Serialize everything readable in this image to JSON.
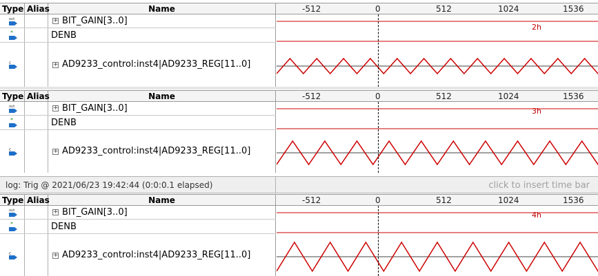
{
  "columns": {
    "type": "Type",
    "alias": "Alias",
    "name": "Name"
  },
  "timeline": {
    "ticks": [
      "-512",
      "0",
      "512",
      "1024",
      "1536"
    ]
  },
  "icons": {
    "output": "output-pin-icon",
    "input": "input-pin-icon",
    "combinational": "combinational-node-icon"
  },
  "colors": {
    "signal": "#cc0000",
    "cursor": "#000000",
    "header_bg": "#f4f4f4"
  },
  "panels": [
    {
      "signals": [
        {
          "name": "BIT_GAIN[3..0]",
          "bus_value": "2h",
          "expandable": true
        },
        {
          "name": "DENB",
          "expandable": false
        },
        {
          "name": "AD9233_control:inst4|AD9233_REG[11..0]",
          "expandable": true
        }
      ],
      "triangle_wave": {
        "periods": 12,
        "min": 0,
        "max": 1
      }
    },
    {
      "signals": [
        {
          "name": "BIT_GAIN[3..0]",
          "bus_value": "3h",
          "expandable": true
        },
        {
          "name": "DENB",
          "expandable": false
        },
        {
          "name": "AD9233_control:inst4|AD9233_REG[11..0]",
          "expandable": true
        }
      ],
      "triangle_wave": {
        "periods": 10,
        "min": 0,
        "max": 1
      }
    },
    {
      "signals": [
        {
          "name": "BIT_GAIN[3..0]",
          "bus_value": "4h",
          "expandable": true
        },
        {
          "name": "DENB",
          "expandable": false
        },
        {
          "name": "AD9233_control:inst4|AD9233_REG[11..0]",
          "expandable": true
        }
      ],
      "triangle_wave": {
        "periods": 9,
        "min": 0,
        "max": 1
      }
    }
  ],
  "log": {
    "text": "log: Trig @ 2021/06/23 19:42:44 (0:0:0.1 elapsed)",
    "hint": "click to insert time bar"
  }
}
